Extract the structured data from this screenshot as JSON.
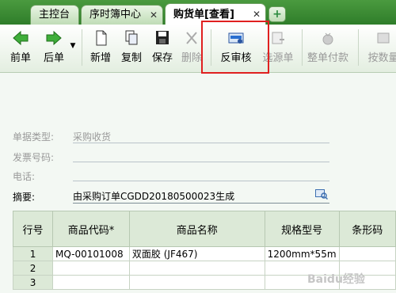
{
  "tabs": [
    {
      "label": "主控台",
      "closable": false,
      "active": false
    },
    {
      "label": "序时簿中心",
      "closable": true,
      "active": false
    },
    {
      "label": "购货单[查看]",
      "closable": true,
      "active": true
    }
  ],
  "add_tab_icon": "plus-icon",
  "toolbar": {
    "prev": "前单",
    "next": "后单",
    "new": "新增",
    "copy": "复制",
    "save": "保存",
    "delete": "删除",
    "unaudit": "反审核",
    "source": "选源单",
    "pay_all": "整单付款",
    "by_qty": "按数量"
  },
  "form": {
    "doc_type_label": "单据类型:",
    "doc_type_value": "采购收货",
    "invoice_label": "发票号码:",
    "phone_label": "电话:",
    "summary_label": "摘要:",
    "summary_value": "由采购订单CGDD20180500023生成"
  },
  "table": {
    "headers": [
      "行号",
      "商品代码*",
      "商品名称",
      "规格型号",
      "条形码"
    ],
    "rows": [
      {
        "no": "1",
        "code": "MQ-00101008",
        "name": "双面胶 (JF467)",
        "spec": "1200mm*55m",
        "barcode": ""
      },
      {
        "no": "2",
        "code": "",
        "name": "",
        "spec": "",
        "barcode": ""
      },
      {
        "no": "3",
        "code": "",
        "name": "",
        "spec": "",
        "barcode": ""
      }
    ]
  },
  "watermark": "Baidu经验"
}
